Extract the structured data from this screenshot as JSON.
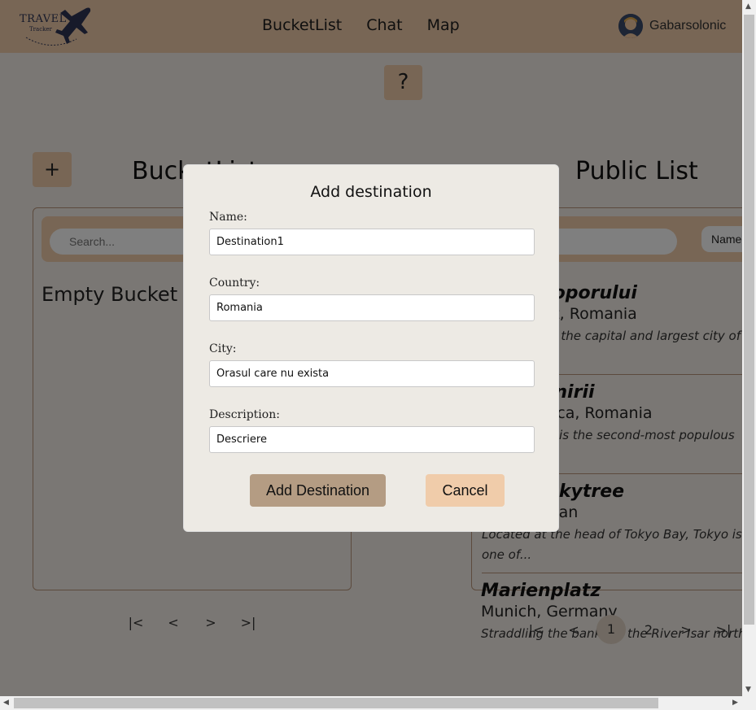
{
  "navbar": {
    "logo_text": "TRAVEL",
    "logo_sub": "Tracker",
    "links": [
      "BucketList",
      "Chat",
      "Map"
    ],
    "username": "Gabarsolonic"
  },
  "help": {
    "label": "?"
  },
  "bucket": {
    "add_label": "+",
    "title": "BucketList",
    "search_placeholder": "Search...",
    "empty_text": "Empty Bucket List"
  },
  "public": {
    "title": "Public List",
    "sort_label": "Name",
    "items": [
      {
        "name": "Piata Poporului",
        "location": "Bucharest, Romania",
        "description": "Bucharest is the capital and largest city of Romania..."
      },
      {
        "name": "Piata Unirii",
        "location": "Cluj-Napoca, Romania",
        "description": "Cluj-Napoca is the second-most populous city..."
      },
      {
        "name": "Tokyo Skytree",
        "location": "Tokyo, Japan",
        "description": "Located at the head of Tokyo Bay, Tokyo is one of..."
      },
      {
        "name": "Marienplatz",
        "location": "Munich, Germany",
        "description": "Straddling the banks of the River Isar north"
      }
    ]
  },
  "pager": {
    "first": "|<",
    "prev": "<",
    "next": ">",
    "last": ">|",
    "pages": [
      "1",
      "2"
    ]
  },
  "modal": {
    "title": "Add destination",
    "fields": [
      {
        "label": "Name:",
        "value": "Destination1"
      },
      {
        "label": "Country:",
        "value": "Romania"
      },
      {
        "label": "City:",
        "value": "Orasul care nu exista"
      },
      {
        "label": "Description:",
        "value": "Descriere"
      }
    ],
    "add_button": "Add Destination",
    "cancel_button": "Cancel"
  },
  "colors": {
    "accent": "#f0ccaa",
    "button_primary": "#b49c83",
    "modal_bg": "#edeae4",
    "border": "#b8957a"
  }
}
